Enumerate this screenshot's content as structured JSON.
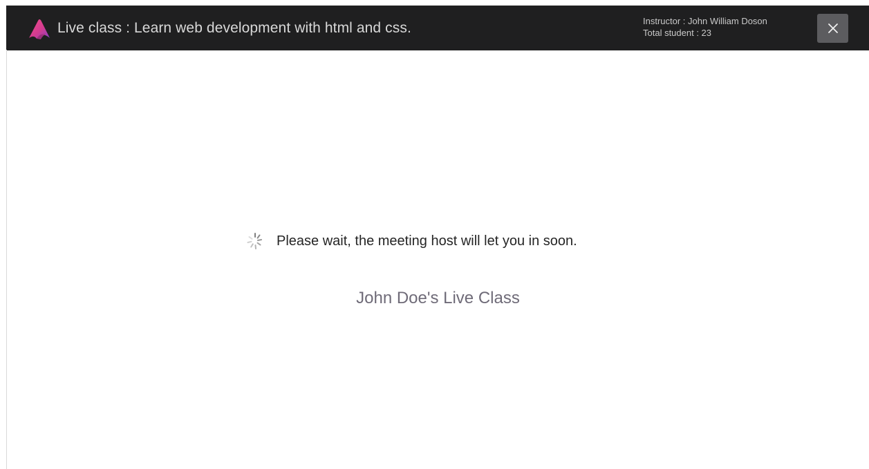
{
  "header": {
    "title": "Live class : Learn web development with html and css.",
    "instructor": "Instructor : John William Doson",
    "total_students": "Total student : 23",
    "close_symbol": "×",
    "logo_icon": "brand-triangle-logo-icon",
    "close_icon": "close-icon"
  },
  "main": {
    "spinner_icon": "loading-spinner-icon",
    "wait_message": "Please wait, the meeting host will let you in soon.",
    "class_name": "John Doe's Live Class"
  },
  "colors": {
    "header_background": "#1f1f20",
    "header_text": "#d8d8d8",
    "close_button_background": "#5c5c5f",
    "logo_primary": "#d33b8f",
    "logo_secondary": "#8c3fcb",
    "class_name_text": "#6f6b78"
  }
}
